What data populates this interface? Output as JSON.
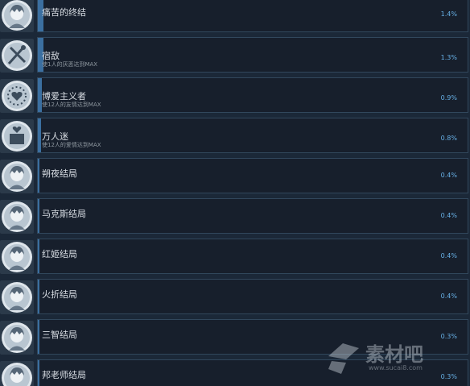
{
  "achievements": [
    {
      "title": "痛苦的终结",
      "desc": "",
      "percent": "1.4%",
      "icon": "anime-portrait-icon"
    },
    {
      "title": "宿敌",
      "desc": "使1人的厌恶达到MAX",
      "percent": "1.3%",
      "icon": "crossed-swords-icon"
    },
    {
      "title": "博爱主义者",
      "desc": "使12人的友情达到MAX",
      "percent": "0.9%",
      "icon": "heart-ring-icon"
    },
    {
      "title": "万人迷",
      "desc": "使12人的爱情达到MAX",
      "percent": "0.8%",
      "icon": "heart-gift-icon"
    },
    {
      "title": "朔夜结局",
      "desc": "",
      "percent": "0.4%",
      "icon": "anime-portrait-icon"
    },
    {
      "title": "马克斯结局",
      "desc": "",
      "percent": "0.4%",
      "icon": "anime-portrait-icon"
    },
    {
      "title": "红姬结局",
      "desc": "",
      "percent": "0.4%",
      "icon": "anime-portrait-icon"
    },
    {
      "title": "火折结局",
      "desc": "",
      "percent": "0.4%",
      "icon": "anime-portrait-icon"
    },
    {
      "title": "三智结局",
      "desc": "",
      "percent": "0.3%",
      "icon": "anime-portrait-icon"
    },
    {
      "title": "邦老师结局",
      "desc": "",
      "percent": "0.3%",
      "icon": "anime-portrait-icon"
    }
  ],
  "watermark": {
    "brand": "素材吧",
    "url": "www.sucai8.com"
  },
  "colors": {
    "background": "#1b2838",
    "card": "#171f2c",
    "border": "#31475c",
    "percent": "#67b0e6",
    "progress": "#3b6fa0"
  }
}
